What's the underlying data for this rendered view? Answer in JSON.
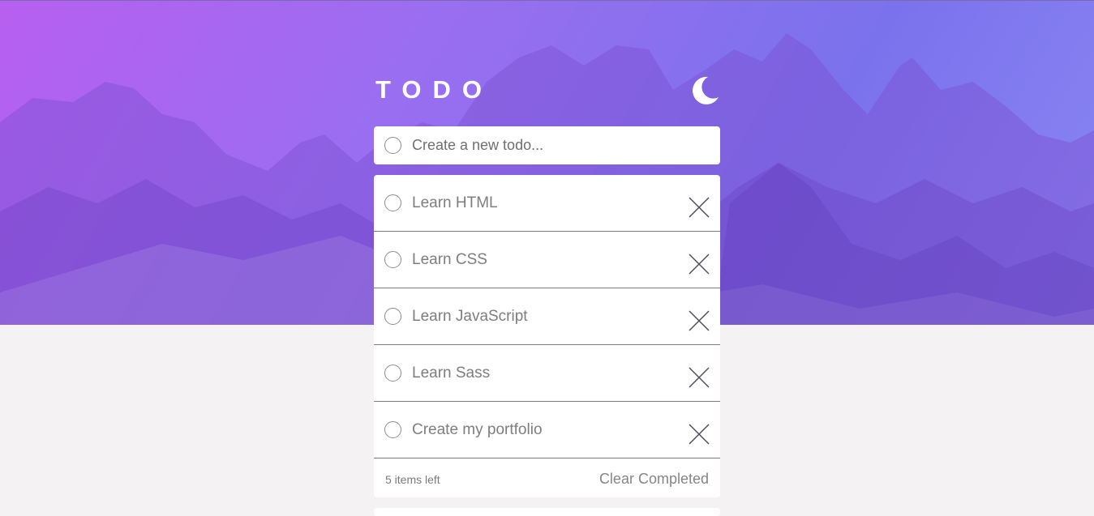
{
  "header": {
    "title": "TODO",
    "theme_icon": "moon-icon"
  },
  "new_todo": {
    "placeholder": "Create a new todo..."
  },
  "todos": [
    {
      "label": "Learn HTML",
      "completed": false
    },
    {
      "label": "Learn CSS",
      "completed": false
    },
    {
      "label": "Learn JavaScript",
      "completed": false
    },
    {
      "label": "Learn Sass",
      "completed": false
    },
    {
      "label": "Create my portfolio",
      "completed": false
    }
  ],
  "footer": {
    "items_left": "5 items left",
    "clear_label": "Clear Completed"
  },
  "colors": {
    "gradient_start": "#b75ff0",
    "gradient_end": "#8a86f4",
    "background": "#f4f2f3",
    "card": "#ffffff"
  }
}
